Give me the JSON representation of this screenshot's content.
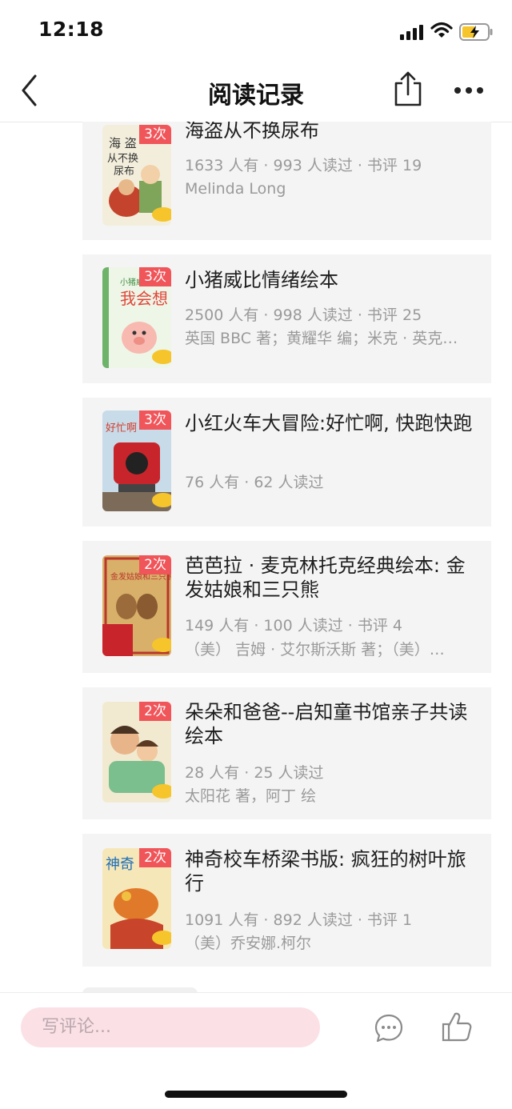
{
  "status_bar": {
    "time": "12:18"
  },
  "nav": {
    "title": "阅读记录"
  },
  "books": [
    {
      "count": "3次",
      "title": "海盗从不换尿布",
      "meta": "1633 人有 · 993 人读过 · 书评 19",
      "author": "Melinda Long"
    },
    {
      "count": "3次",
      "title": "小猪威比情绪绘本",
      "meta": "2500 人有 · 998 人读过 · 书评 25",
      "author": "英国 BBC 著；黄耀华 编；米克 · 英克…"
    },
    {
      "count": "3次",
      "title": "小红火车大冒险:好忙啊, 快跑快跑",
      "meta": "76 人有 · 62 人读过",
      "author": ""
    },
    {
      "count": "2次",
      "title": "芭芭拉 · 麦克林托克经典绘本: 金发姑娘和三只熊",
      "meta": "149 人有 · 100 人读过 · 书评 4",
      "author": "（美） 吉姆 · 艾尔斯沃斯 著；（美）…"
    },
    {
      "count": "2次",
      "title": "朵朵和爸爸--启知童书馆亲子共读绘本",
      "meta": "28 人有 · 25 人读过",
      "author": "太阳花 著，阿丁 绘"
    },
    {
      "count": "2次",
      "title": "神奇校车桥梁书版: 疯狂的树叶旅行",
      "meta": "1091 人有 · 892 人读过 · 书评 1",
      "author": "（美）乔安娜.柯尔"
    }
  ],
  "bottom_bar": {
    "comment_placeholder": "写评论..."
  },
  "colors": {
    "badge": "#f0555a",
    "input_bg": "#fbe1e6",
    "card_bg": "#f4f4f4"
  },
  "icons": [
    "back-icon",
    "share-icon",
    "more-icon",
    "comment-icon",
    "like-icon"
  ]
}
